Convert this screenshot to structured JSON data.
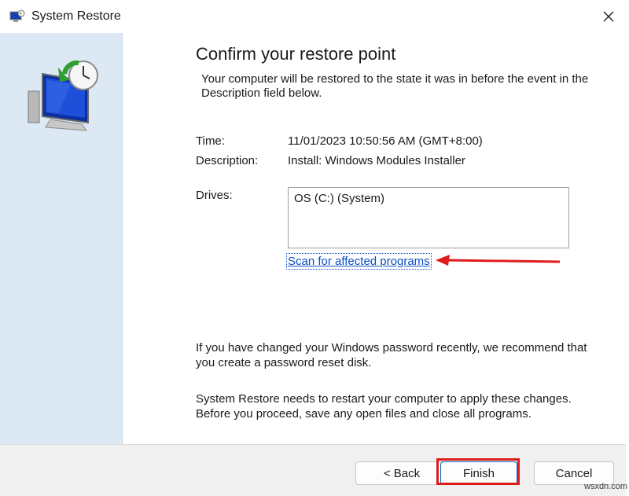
{
  "window": {
    "title": "System Restore",
    "close_icon": "close-icon"
  },
  "main": {
    "heading": "Confirm your restore point",
    "intro": "Your computer will be restored to the state it was in before the event in the Description field below.",
    "time_label": "Time:",
    "time_value": "11/01/2023 10:50:56 AM (GMT+8:00)",
    "description_label": "Description:",
    "description_value": "Install: Windows Modules Installer",
    "drives_label": "Drives:",
    "drives": [
      "OS (C:) (System)"
    ],
    "scan_link": "Scan for affected programs",
    "password_note": "If you have changed your Windows password recently, we recommend that you create a password reset disk.",
    "restart_note": "System Restore needs to restart your computer to apply these changes. Before you proceed, save any open files and close all programs."
  },
  "footer": {
    "back_label": "< Back",
    "finish_label": "Finish",
    "cancel_label": "Cancel"
  },
  "annotations": {
    "arrow_color": "#e01b1b",
    "highlight_color": "#e01b1b"
  },
  "watermark": "wsxdn.com"
}
